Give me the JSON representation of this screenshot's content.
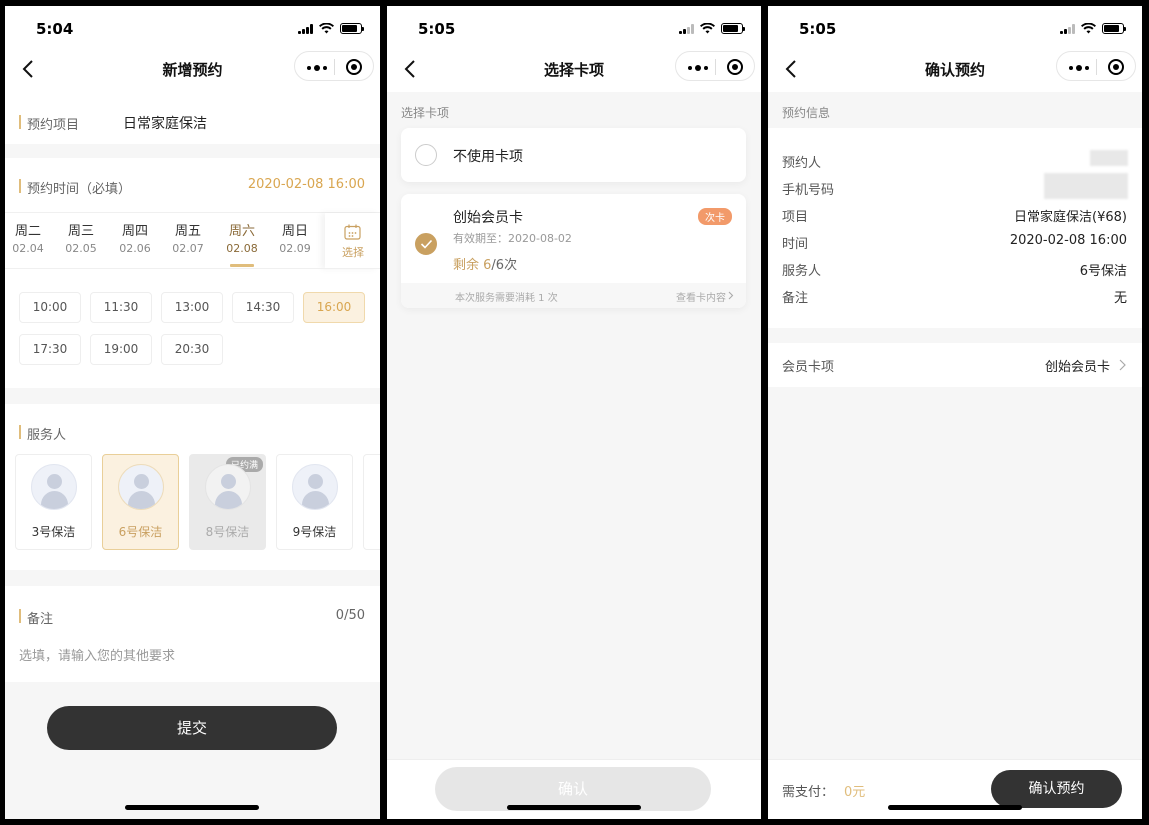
{
  "status": {
    "time1": "5:04",
    "time2": "5:05",
    "time3": "5:05"
  },
  "screen1": {
    "title": "新增预约",
    "item_label": "预约项目",
    "item_value": "日常家庭保洁",
    "time_label": "预约时间（必填）",
    "time_value": "2020-02-08 16:00",
    "days": [
      {
        "w": "周二",
        "d": "02.04"
      },
      {
        "w": "周三",
        "d": "02.05"
      },
      {
        "w": "周四",
        "d": "02.06"
      },
      {
        "w": "周五",
        "d": "02.07"
      },
      {
        "w": "周六",
        "d": "02.08"
      },
      {
        "w": "周日",
        "d": "02.09"
      }
    ],
    "select_label": "选择",
    "slots": [
      "10:00",
      "11:30",
      "13:00",
      "14:30",
      "16:00",
      "17:30",
      "19:00",
      "20:30"
    ],
    "staff_label": "服务人",
    "staff": [
      "3号保洁",
      "6号保洁",
      "8号保洁",
      "9号保洁"
    ],
    "full_tag": "已约满",
    "remark_label": "备注",
    "remark_count": "0/50",
    "remark_placeholder": "选填，请输入您的其他要求",
    "submit": "提交"
  },
  "screen2": {
    "title": "选择卡项",
    "section": "选择卡项",
    "no_card": "不使用卡项",
    "card_name": "创始会员卡",
    "card_tag": "次卡",
    "card_expiry": "有效期至：2020-08-02",
    "card_remain_prefix": "剩余 ",
    "card_remain_num": "6",
    "card_remain_suffix": "/6次",
    "card_note": "本次服务需要消耗 1 次",
    "card_view": "查看卡内容",
    "confirm": "确认"
  },
  "screen3": {
    "title": "确认预约",
    "section": "预约信息",
    "rows": [
      {
        "k": "预约人",
        "v": ""
      },
      {
        "k": "手机号码",
        "v": ""
      },
      {
        "k": "项目",
        "v": "日常家庭保洁(¥68)"
      },
      {
        "k": "时间",
        "v": "2020-02-08 16:00"
      },
      {
        "k": "服务人",
        "v": "6号保洁"
      },
      {
        "k": "备注",
        "v": "无"
      }
    ],
    "card_label": "会员卡项",
    "card_value": "创始会员卡",
    "pay_label": "需支付：",
    "pay_value": "0元",
    "confirm": "确认预约"
  },
  "colors": {
    "accent": "#c9a060",
    "dark": "#333333",
    "tag": "#f29a6a"
  }
}
